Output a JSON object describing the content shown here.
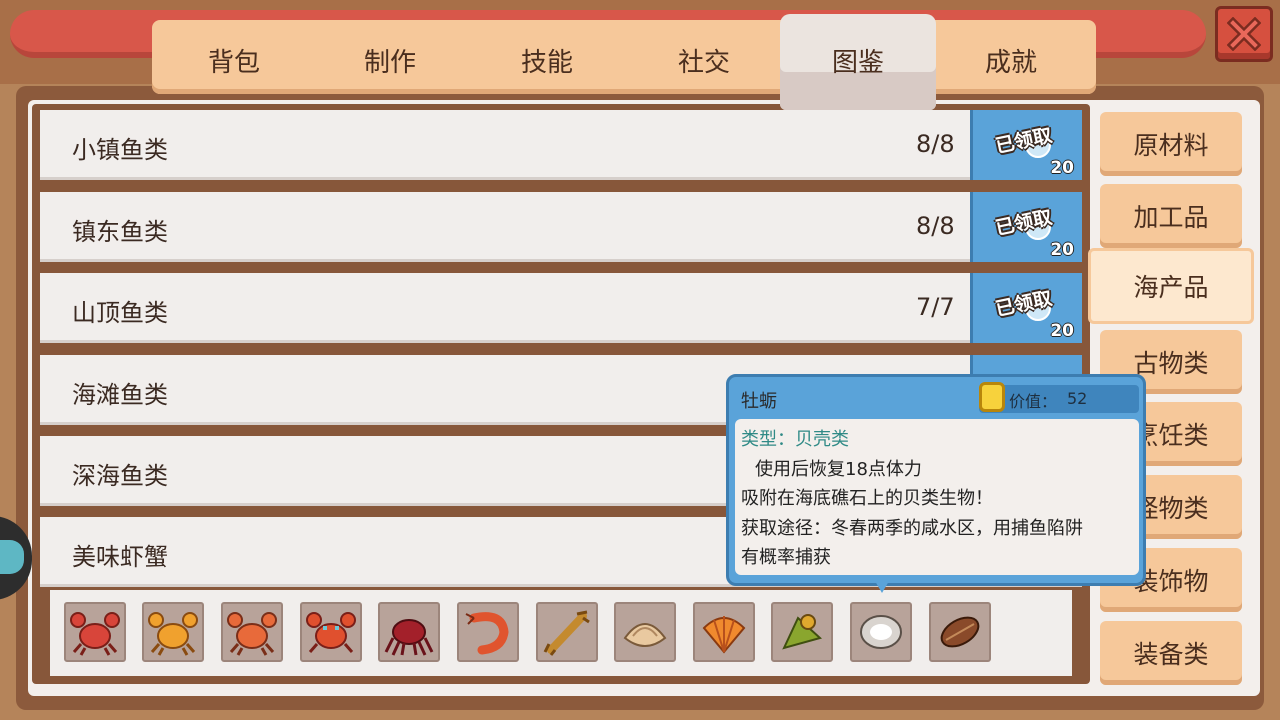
{
  "window": {
    "close_icon": "close-icon",
    "accent_color": "#d6503f"
  },
  "tabs": [
    {
      "label": "背包",
      "active": false
    },
    {
      "label": "制作",
      "active": false
    },
    {
      "label": "技能",
      "active": false
    },
    {
      "label": "社交",
      "active": false
    },
    {
      "label": "图鉴",
      "active": true
    },
    {
      "label": "成就",
      "active": false
    }
  ],
  "collections": [
    {
      "name": "小镇鱼类",
      "count": "8/8",
      "reward_status": "已领取",
      "reward_amount": "20"
    },
    {
      "name": "镇东鱼类",
      "count": "8/8",
      "reward_status": "已领取",
      "reward_amount": "20"
    },
    {
      "name": "山顶鱼类",
      "count": "7/7",
      "reward_status": "已领取",
      "reward_amount": "20"
    },
    {
      "name": "海滩鱼类"
    },
    {
      "name": "深海鱼类"
    },
    {
      "name": "美味虾蟹"
    }
  ],
  "items": [
    {
      "icon": "red-crab-icon"
    },
    {
      "icon": "orange-crab-icon"
    },
    {
      "icon": "orange-red-crab-icon"
    },
    {
      "icon": "blue-crab-icon"
    },
    {
      "icon": "dark-red-crab-icon"
    },
    {
      "icon": "shrimp-icon"
    },
    {
      "icon": "lobster-icon"
    },
    {
      "icon": "clam-icon"
    },
    {
      "icon": "scallop-icon"
    },
    {
      "icon": "green-snail-icon"
    },
    {
      "icon": "oyster-icon"
    },
    {
      "icon": "mussel-icon"
    }
  ],
  "categories": [
    {
      "label": "原材料",
      "active": false
    },
    {
      "label": "加工品",
      "active": false
    },
    {
      "label": "海产品",
      "active": true
    },
    {
      "label": "古物类",
      "active": false
    },
    {
      "label": "烹饪类",
      "active": false
    },
    {
      "label": "怪物类",
      "active": false
    },
    {
      "label": "装饰物",
      "active": false
    },
    {
      "label": "装备类",
      "active": false
    }
  ],
  "tooltip": {
    "name": "牡蛎",
    "value_label": "价值：",
    "value": "52",
    "type_line": "类型：贝壳类",
    "effect": "使用后恢复18点体力",
    "description": "吸附在海底礁石上的贝类生物！",
    "source_line1": "获取途径：冬春两季的咸水区，用捕鱼陷阱",
    "source_line2": "有概率捕获"
  }
}
